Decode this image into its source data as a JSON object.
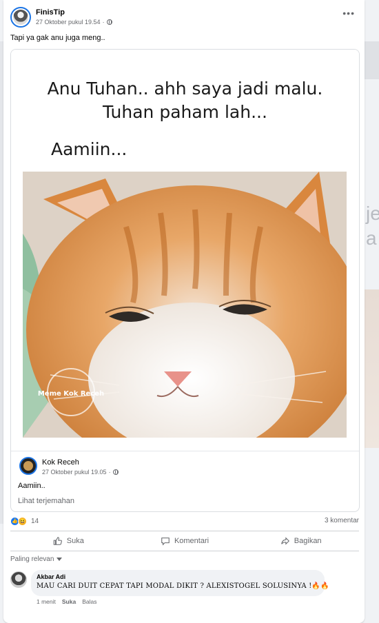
{
  "post": {
    "author": "FinisTip",
    "timestamp": "27 Oktober pukul 19.54",
    "privacy_icon": "globe-icon",
    "more_label": "•••",
    "text": "Tapi ya gak anu juga meng.."
  },
  "meme": {
    "caption_line1": "Anu Tuhan.. ahh saya jadi malu.",
    "caption_line2": "Tuhan paham lah...",
    "caption_line3": "Aamiin...",
    "watermark": "Meme Kok Receh"
  },
  "shared_post": {
    "author": "Kok Receh",
    "timestamp": "27 Oktober pukul 19.05",
    "text": "Aamiin..",
    "translate_link": "Lihat terjemahan"
  },
  "stats": {
    "reactions": [
      "like",
      "haha"
    ],
    "reaction_count": "14",
    "comment_count": "3 komentar"
  },
  "actions": {
    "like": "Suka",
    "comment": "Komentari",
    "share": "Bagikan"
  },
  "comments": {
    "sort_label": "Paling relevan",
    "items": [
      {
        "author": "Akbar Adi",
        "text": "MAU CARI DUIT CEPAT TAPI MODAL DIKIT ? ALEXISTOGEL SOLUSINYA !🔥🔥",
        "time": "1 menit",
        "like_label": "Suka",
        "reply_label": "Balas"
      }
    ]
  },
  "background": {
    "right_text": "je a"
  },
  "colors": {
    "accent": "#1877f2",
    "secondary_text": "#65676b",
    "divider": "#ced0d4"
  }
}
